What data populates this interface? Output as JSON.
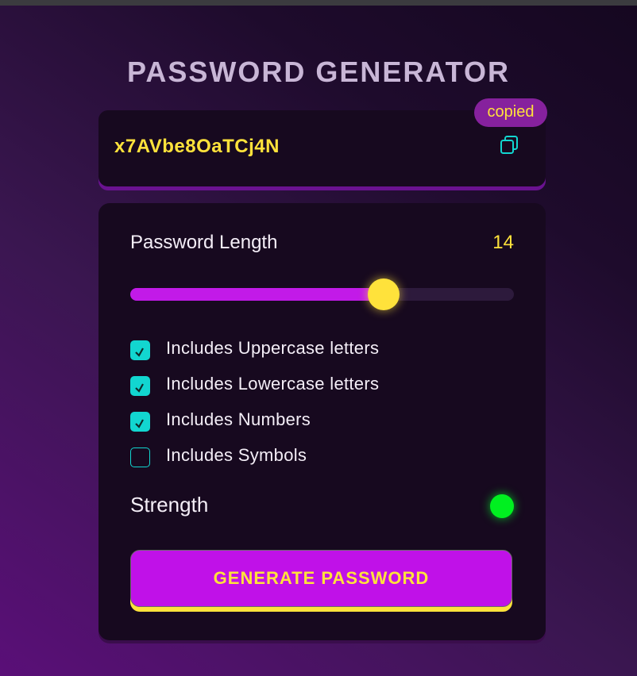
{
  "app": {
    "title": "PASSWORD GENERATOR"
  },
  "display": {
    "password": "x7AVbe8OaTCj4N",
    "copy_icon": "copy-icon",
    "copied_badge": "copied"
  },
  "length": {
    "label": "Password Length",
    "value": "14",
    "slider_fraction": 0.66
  },
  "options": [
    {
      "label": "Includes Uppercase letters",
      "checked": true
    },
    {
      "label": "Includes Lowercase letters",
      "checked": true
    },
    {
      "label": "Includes Numbers",
      "checked": true
    },
    {
      "label": "Includes Symbols",
      "checked": false
    }
  ],
  "strength": {
    "label": "Strength",
    "indicator_color": "#00f020"
  },
  "generate_button": {
    "label": "GENERATE PASSWORD"
  },
  "colors": {
    "accent_yellow": "#ffe23b",
    "accent_purple": "#c011e8",
    "checkbox_teal": "#12d6d0",
    "panel_bg": "#17091f"
  }
}
